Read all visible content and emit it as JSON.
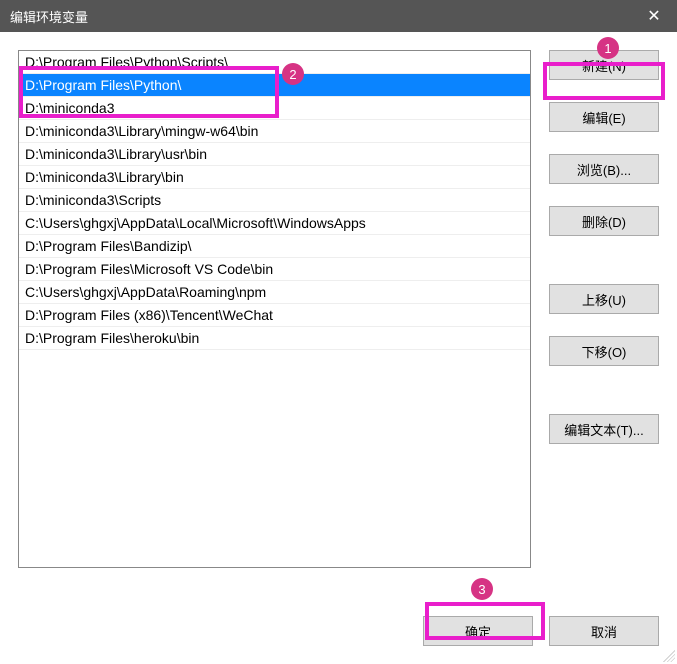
{
  "window": {
    "title": "编辑环境变量"
  },
  "list": {
    "selected_index": 1,
    "items": [
      "D:\\Program Files\\Python\\Scripts\\",
      "D:\\Program Files\\Python\\",
      "D:\\miniconda3",
      "D:\\miniconda3\\Library\\mingw-w64\\bin",
      "D:\\miniconda3\\Library\\usr\\bin",
      "D:\\miniconda3\\Library\\bin",
      "D:\\miniconda3\\Scripts",
      "C:\\Users\\ghgxj\\AppData\\Local\\Microsoft\\WindowsApps",
      "D:\\Program Files\\Bandizip\\",
      "D:\\Program Files\\Microsoft VS Code\\bin",
      "C:\\Users\\ghgxj\\AppData\\Roaming\\npm",
      "D:\\Program Files (x86)\\Tencent\\WeChat",
      "D:\\Program Files\\heroku\\bin"
    ]
  },
  "buttons": {
    "new": "新建(N)",
    "edit": "编辑(E)",
    "browse": "浏览(B)...",
    "delete": "删除(D)",
    "move_up": "上移(U)",
    "move_down": "下移(O)",
    "edit_text": "编辑文本(T)...",
    "ok": "确定",
    "cancel": "取消"
  },
  "annotations": {
    "1": "1",
    "2": "2",
    "3": "3"
  }
}
